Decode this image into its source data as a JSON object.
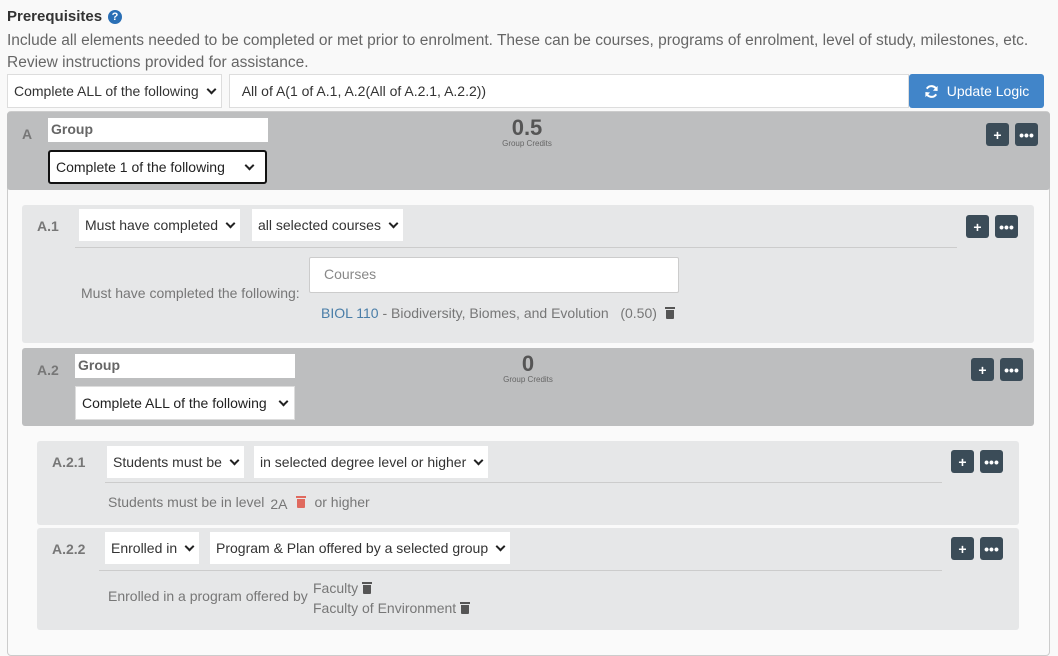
{
  "header": {
    "title": "Prerequisites",
    "help_icon": "question-circle-icon",
    "description": "Include all elements needed to be completed or met prior to enrolment. These can be courses, programs of enrolment, level of study, milestones, etc. Review instructions provided for assistance."
  },
  "topbar": {
    "condition_select": "Complete ALL of the following",
    "logic_value": "All of A(1 of A.1, A.2(All of A.2.1, A.2.2))",
    "update_button": "Update Logic",
    "update_icon": "refresh-icon"
  },
  "groupA": {
    "label": "A",
    "name": "Group",
    "condition_select": "Complete 1 of the following",
    "credits": "0.5",
    "credits_caption": "Group Credits",
    "add_button": "+",
    "more_button": "•••"
  },
  "ruleA1": {
    "label": "A.1",
    "select1": "Must have completed",
    "select2": "all selected courses",
    "text": "Must have completed the following:",
    "courses_placeholder": "Courses",
    "course_code": "BIOL 110",
    "course_title": " - Biodiversity, Biomes, and Evolution",
    "course_credits": "(0.50)",
    "add_button": "+",
    "more_button": "•••"
  },
  "groupA2": {
    "label": "A.2",
    "name": "Group",
    "condition_select": "Complete ALL of the following",
    "credits": "0",
    "credits_caption": "Group Credits",
    "add_button": "+",
    "more_button": "•••"
  },
  "ruleA21": {
    "label": "A.2.1",
    "select1": "Students must be",
    "select2": "in selected degree level or higher",
    "text_before": "Students must be in level",
    "level": "2A",
    "text_after": "or higher",
    "add_button": "+",
    "more_button": "•••"
  },
  "ruleA22": {
    "label": "A.2.2",
    "select1": "Enrolled in",
    "select2": "Program & Plan offered by a selected group",
    "text": "Enrolled in a program offered by",
    "items": [
      "Faculty",
      "Faculty of Environment"
    ],
    "add_button": "+",
    "more_button": "•••"
  }
}
